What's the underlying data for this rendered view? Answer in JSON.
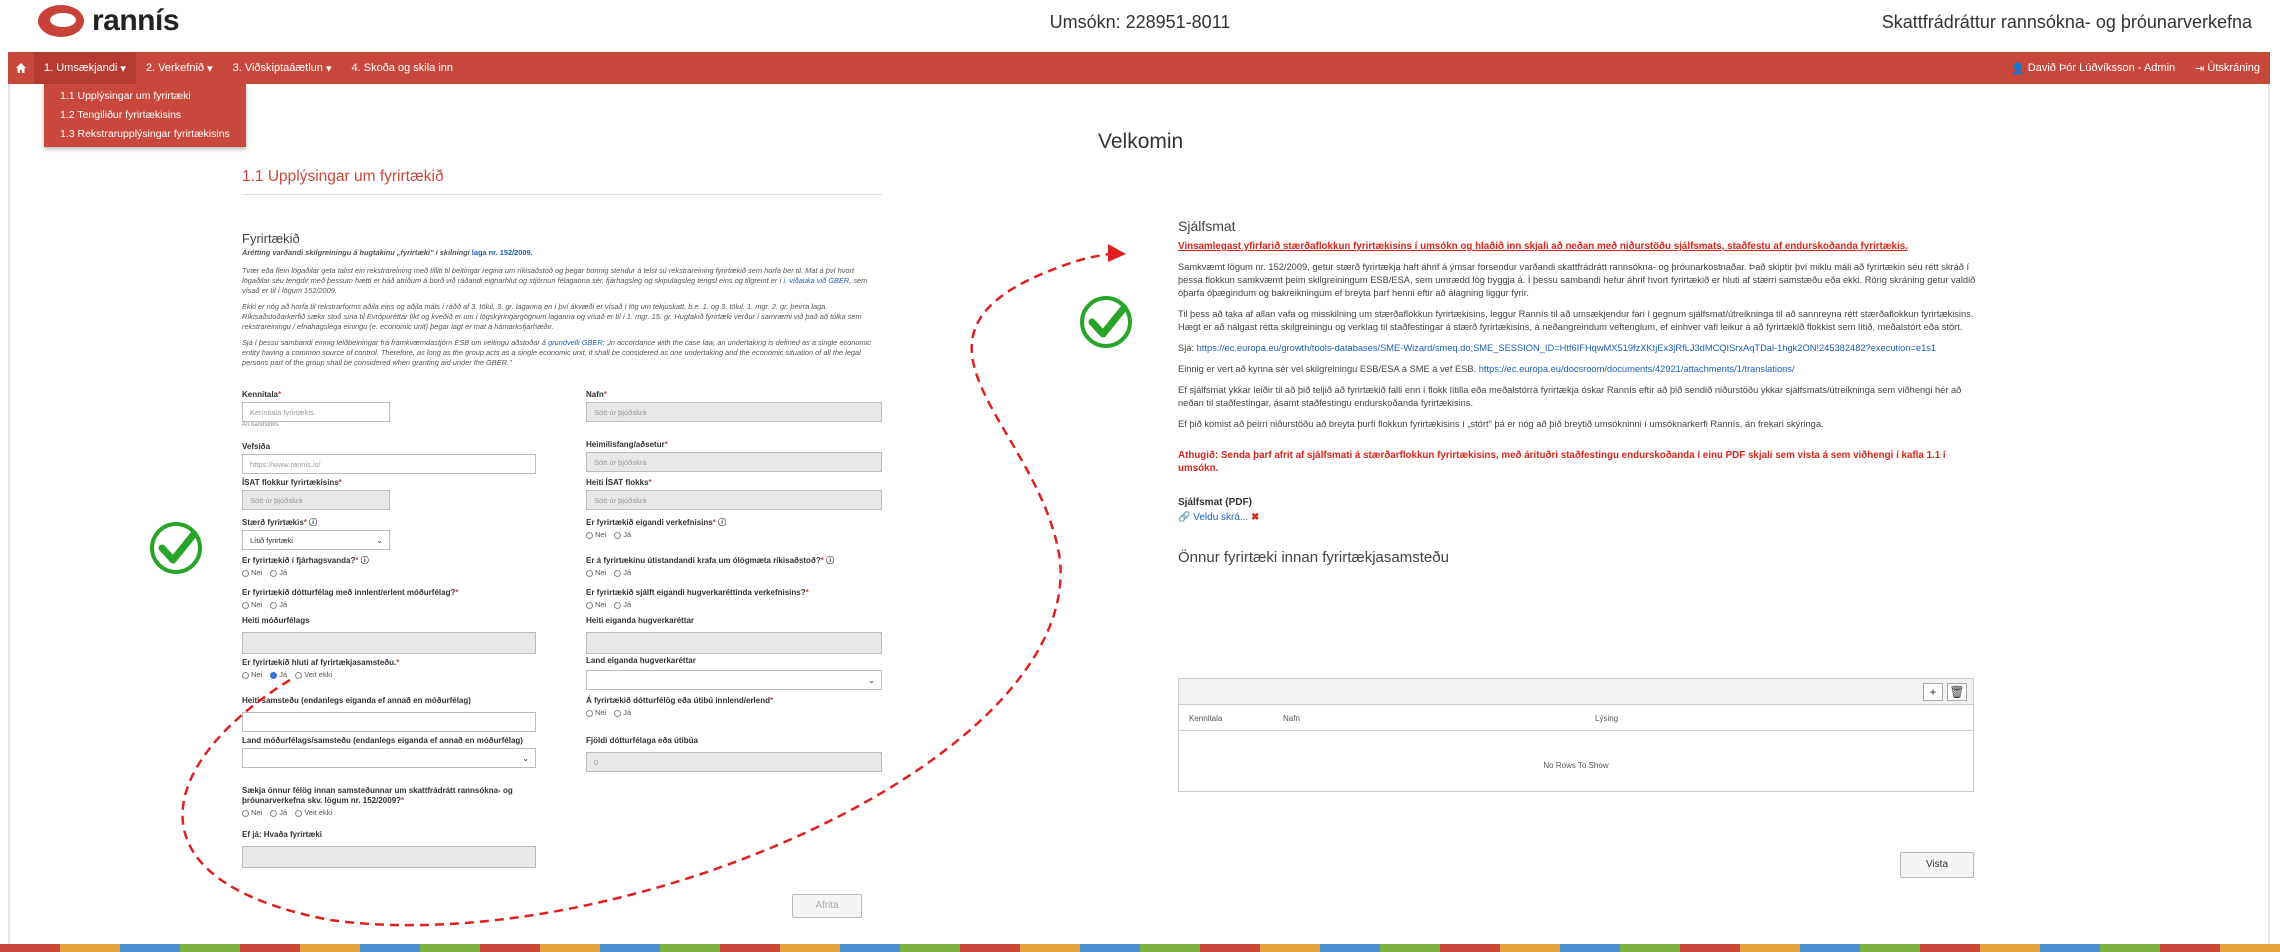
{
  "header": {
    "logo_text": "rannís",
    "application_number": "Umsókn: 228951-8011",
    "program_name": "Skattfrádráttur rannsókna- og þróunarverkefna"
  },
  "nav": {
    "items": [
      "1. Umsækjandi",
      "2. Verkefnið",
      "3. Viðskiptaáætlun",
      "4. Skoða og skila inn"
    ],
    "user": "Davið Þór Lúðvíksson - Admin",
    "logout": "Útskráning"
  },
  "dropdown": [
    "1.1 Upplýsingar um fyrirtæki",
    "1.2 Tengiliður fyrirtækisins",
    "1.3 Rekstrarupplýsingar fyrirtækisins"
  ],
  "welcome": "Velkomin",
  "form": {
    "section_title": "1.1 Upplýsingar um fyrirtækið",
    "subtitle": "Fyrirtækið",
    "intro_bold": "Áréttíng varðandi skilgreiningu á hugtakinu „fyrirtæki\" í skilningi",
    "intro_link": "laga nr. 152/2009.",
    "para1": "Tvær eða fleiri lögaðilar geta talist ein rekstrareining með tilliti til beitingar regina um ríkisaðstoð og þegar bonnig stendur á telst sú rekstrareining fyrirtækið sem horfa ber til. Mat á því hvort lögaðilar séu tengdir með þessum hætti er háð atriðum á borð við ráðandi eignarhlut og stjórnun félaganna sér, fjárhagsleg og skipulagsleg tengsl eins og tilgreint er í",
    "para1_link": "i. viðauka við GBER",
    "para1_end": ", sem vísað er til í lögum 152/2009.",
    "para2": "Ekki er nóg að horfa til rekstrarforms aðila eins og aðila máls í ráðð af 3. tölul. 3. gr. laganna en í því ákvæði er vísað í lög um tekjuskatt, b.e. 1. og 3. tölul. 1. mgr. 2. gr. þeirra laga. Ríkisaðstoðarkerfið sækir stoð sína til Evrópuréttar líkt og kveðið er um í lögskýringargögnum laganna og vísað er til í 1. mgr. 15. gr. Hugtakið fyrirtæki verður í samræmi við það að túlka sem rekstrareiningu / efnahagslega einingu (e. economic unit) þegar lagt er mat á hámarksfjárhæðir.",
    "para3": "Sjá í þessu sambandi einnig leiðbeiningar frá framkvæmdastjórn ESB um veitingu aðstoðar á",
    "para3_link": "grundvelli GBER",
    "para3_end": "; „in accordance with the case law, an undertaking is defined as a single economic entity having a common source of control. Therefore, as long as the group acts as a single economic unit, it shall be considered as one undertaking and the economic situation of all the legal persons part of the group shall be considered when granting aid under the GBER.\"",
    "fields": {
      "kennitala": {
        "label": "Kennitala",
        "placeholder": "Kennitala fyrirtækis",
        "hint": "Án bandstriks"
      },
      "nafn": {
        "label": "Nafn",
        "placeholder": "Sótt úr þjóðskrá"
      },
      "vefsida": {
        "label": "Vefsíða",
        "placeholder": "https://www.rannis.is/"
      },
      "heimilisfang": {
        "label": "Heimilisfang/aðsetur",
        "placeholder": "Sótt úr þjóðskrá"
      },
      "isat": {
        "label": "ÍSAT flokkur fyrirtækisins",
        "placeholder": "Sótt úr þjóðskrá"
      },
      "heiti_isat": {
        "label": "Heiti ÍSAT flokks",
        "placeholder": "Sótt úr þjóðskrá"
      },
      "staerd": {
        "label": "Stærð fyrirtækis",
        "value": "Lítið fyrirtæki"
      },
      "eigandi": {
        "label": "Er fyrirtækið eigandi verkefnisins"
      },
      "fjarhagsvanda": {
        "label": "Er fyrirtækið í fjárhagsvanda?"
      },
      "utistandandi": {
        "label": "Er á fyrirtækinu útistandandi krafa um ólögmæta ríkisaðstoð?"
      },
      "dotturfelag": {
        "label": "Er fyrirtækið dótturfélag með innlent/erlent móðurfélag?"
      },
      "hugverkarettinda": {
        "label": "Er fyrirtækið sjálft eigandi hugverkaréttinda verkefnisins?"
      },
      "heiti_modurfelags": {
        "label": "Heiti móðurfélags"
      },
      "heiti_eiganda": {
        "label": "Heiti eiganda hugverkaréttar"
      },
      "samsteypa": {
        "label": "Er fyrirtækið hluti af fyrirtækjasamsteðu."
      },
      "land_eiganda": {
        "label": "Land eiganda hugverkaréttar"
      },
      "heiti_samsteypu": {
        "label": "Heiti samsteðu (endanlegs eiganda ef annað en móðurfélag)"
      },
      "dotturfelog_utibu": {
        "label": "Á fyrirtækið dótturfélög eða útibú innlend/erlend"
      },
      "land_modurfelags": {
        "label": "Land móðurfélags/samsteðu (endanlegs eiganda ef annað en móðurfélag)"
      },
      "fjoldi": {
        "label": "Fjöldi dótturfélaga eða útibúa",
        "value": "0"
      },
      "saekja": {
        "label": "Sækja önnur félög innan samsteðunnar um skattfrádrátt rannsókna- og þróunarverkefna skv. lögum nr. 152/2009?"
      },
      "ef_ja": {
        "label": "Ef já: Hvaða fyrirtæki"
      }
    },
    "radio": {
      "nei": "Nei",
      "ja": "Já",
      "veit_ekki": "Veit ekki"
    },
    "copy_button": "Afrita"
  },
  "self": {
    "title": "Sjálfsmat",
    "warn": "Vinsamlegast yfirfarið stærðaflokkun fyrirtækisins í umsókn og hlaðið inn skjali að neðan með niðurstöðu sjálfsmats, staðfestu af endurskoðanda fyrirtækis.",
    "p1": "Samkvæmt lögum nr. 152/2009, getur stærð fyrirtækja haft áhrif á ýmsar forsendur varðandi skattfrádrátt rannsókna- og þróunarkostnaðar. Það skiptir því miklu máli að fyrirtækin séu rétt skráð í þessa flokkun samkvæmt þeim skilgreiningum ESB/ESA, sem umrædd lög byggja á. Í þessu sambandi hefur áhrif hvort fyrirtækið er hluti af stærri samstæðu eða ekki. Röng skráning getur valdið óþarfa óþægindum og bakreikningum ef breyta þarf henni eftir að álagning liggur fyrir.",
    "p2": "Til þess að taka af allan vafa og misskilning um stærðaflokkun fyrirtækisins, leggur Rannís til að umsækjendur fari í gegnum sjálfsmat/útreikninga til að sannreyna rétt stærðaflokkun fyrirtækisins. Hægt er að nálgast rétta skilgreiningu og verklag til staðfestingar á stærð fyrirtækisins, á neðangreindum veftenglum, ef einhver vafi leikur á að fyrirtækið flokkist sem lítið, meðalstórt eða stórt.",
    "p3_pre": "Sjá:",
    "p3_link": "https://ec.europa.eu/growth/tools-databases/SME-Wizard/smeq.do;SME_SESSION_ID=Htf6IFHqwMX519fzXKtjEx3jRfLJ3dMCQISrxAqTDal-1hgk2ON!245382482?execution=e1s1",
    "p4_pre": "Einnig er vert að kynna sér vel skilgreiningu ESB/ESA á SME á vef ESB.",
    "p4_link": "https://ec.europa.eu/docsroom/documents/42921/attachments/1/translations/",
    "p5": "Ef sjálfsmat ykkar leiðir til að þið teljið að fyrirtækið falli enn í flokk lítilla eða meðalstórra fyrirtækja óskar Rannís eftir að þið sendið niðurstöðu ykkar sjálfsmats/útreikninga sem viðhengi hér að neðan til staðfestingar, ásamt staðfestingu endurskoðanda fyrirtækisins.",
    "p6": "Ef þið komist að þeirri niðurstöðu að breyta þurfi flokkun fyrirtækisins í „stórt\" þá er nóg að þið breytið umsókninni í umsóknarkerfi Rannís, án frekari skýringa.",
    "warn2": "Athugið: Senda þarf afrit af sjálfsmati á stærðarflokkun fyrirtækisins, með árituðri staðfestingu endurskoðanda í einu PDF skjali sem vista á sem viðhengi í kafla 1.1 í umsókn.",
    "upload_label": "Sjálfsmat (PDF)",
    "upload_link": "Veldu skrá...",
    "group_title": "Önnur fyrirtæki innan fyrirtækjasamsteðu",
    "columns": [
      "Kennitala",
      "Nafn",
      "Lýsing"
    ],
    "no_rows": "No Rows To Show",
    "save_button": "Vista"
  },
  "colors": {
    "brand": "#c8493c",
    "warn": "#d9261c",
    "link": "#1e5fb5",
    "check": "#28a428"
  }
}
